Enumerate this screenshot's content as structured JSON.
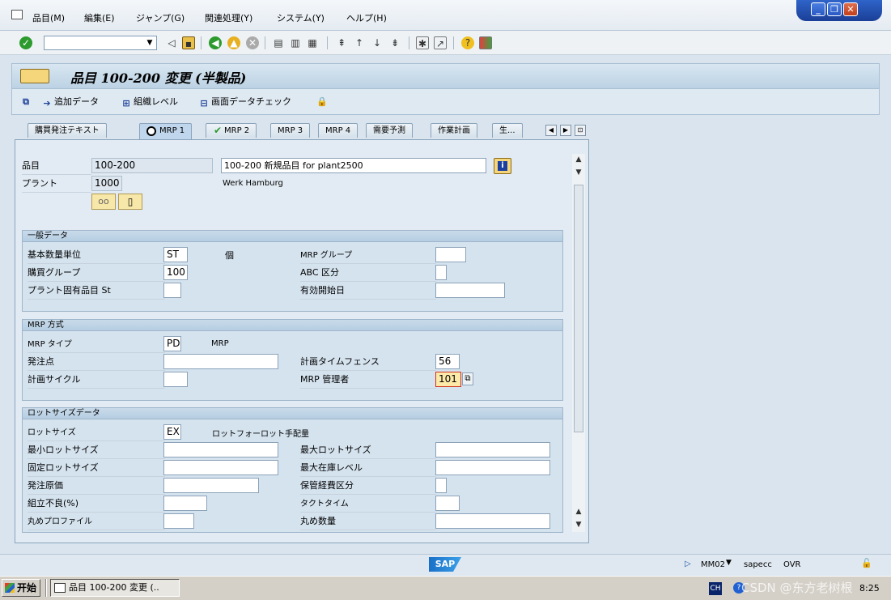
{
  "menu": {
    "items": [
      "品目(M)",
      "編集(E)",
      "ジャンプ(G)",
      "関連処理(Y)",
      "システム(Y)",
      "ヘルプ(H)"
    ]
  },
  "window_buttons": {
    "minimize": "_",
    "restore": "❐",
    "close": "✕"
  },
  "title": "品目 100-200 変更 (半製品)",
  "app_toolbar": {
    "add_data": "追加データ",
    "org_level": "組織レベル",
    "screen_check": "画面データチェック"
  },
  "tabs": [
    "購買発注テキスト",
    "MRP 1",
    "MRP 2",
    "MRP 3",
    "MRP 4",
    "需要予測",
    "作業計画",
    "生..."
  ],
  "header": {
    "material_label": "品目",
    "material_value": "100-200",
    "material_desc": "100-200 新規品目 for plant2500",
    "plant_label": "プラント",
    "plant_value": "1000",
    "plant_name": "Werk Hamburg"
  },
  "general": {
    "title": "一般データ",
    "base_uom_label": "基本数量単位",
    "base_uom_value": "ST",
    "base_uom_text": "個",
    "purch_group_label": "購買グループ",
    "purch_group_value": "100",
    "plant_sp_label": "プラント固有品目 St",
    "plant_sp_value": "",
    "mrp_group_label": "MRP グループ",
    "mrp_group_value": "",
    "abc_label": "ABC 区分",
    "abc_value": "",
    "valid_from_label": "有効開始日",
    "valid_from_value": ""
  },
  "mrp_proc": {
    "title": "MRP 方式",
    "mrp_type_label": "MRP タイプ",
    "mrp_type_value": "PD",
    "mrp_type_text": "MRP",
    "reorder_label": "発注点",
    "reorder_value": "",
    "fence_label": "計画タイムフェンス",
    "fence_value": "56",
    "cycle_label": "計画サイクル",
    "cycle_value": "",
    "controller_label": "MRP 管理者",
    "controller_value": "101"
  },
  "lot": {
    "title": "ロットサイズデータ",
    "lot_size_label": "ロットサイズ",
    "lot_size_value": "EX",
    "lot_size_text": "ロットフォーロット手配量",
    "min_label": "最小ロットサイズ",
    "max_label": "最大ロットサイズ",
    "fixed_label": "固定ロットサイズ",
    "max_stock_label": "最大在庫レベル",
    "order_cost_label": "発注原価",
    "storage_cost_label": "保管経費区分",
    "scrap_label": "組立不良(%)",
    "takt_label": "タクトタイム",
    "round_profile_label": "丸めプロファイル",
    "round_qty_label": "丸め数量"
  },
  "status": {
    "tcode": "MM02",
    "server": "sapecc",
    "mode": "OVR",
    "brand": "SAP"
  },
  "taskbar": {
    "start": "开始",
    "task": "品目 100-200 変更 (..",
    "lang": "CH",
    "clock": "8:25",
    "watermark": "CSDN @东方老树根"
  }
}
